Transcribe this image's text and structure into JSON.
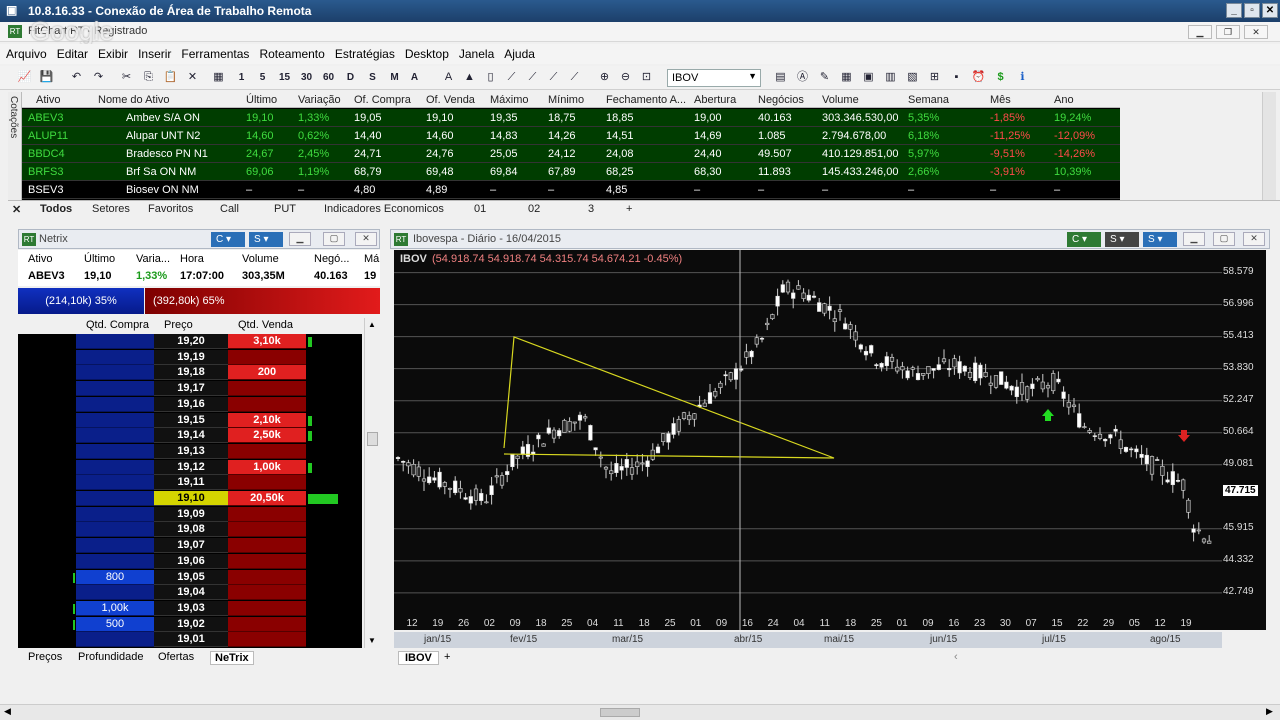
{
  "window": {
    "rd_title": "10.8.16.33 - Conexão de Área de Trabalho Remota",
    "app_title": "FitChart RT - Registrado",
    "watermark": "Google"
  },
  "menu": [
    "Arquivo",
    "Editar",
    "Exibir",
    "Inserir",
    "Ferramentas",
    "Roteamento",
    "Estratégias",
    "Desktop",
    "Janela",
    "Ajuda"
  ],
  "toolbar": {
    "symbol_select": "IBOV",
    "timeframes": [
      "1",
      "5",
      "15",
      "30",
      "60",
      "D",
      "S",
      "M",
      "A"
    ]
  },
  "quotes": {
    "side_label": "Cotações",
    "headers": [
      "Ativo",
      "Nome do Ativo",
      "Último",
      "Variação",
      "Of. Compra",
      "Of. Venda",
      "Máximo",
      "Mínimo",
      "Fechamento A...",
      "Abertura",
      "Negócios",
      "Volume",
      "Semana",
      "Mês",
      "Ano"
    ],
    "rows": [
      [
        "ABEV3",
        "Ambev S/A ON",
        "19,10",
        "1,33%",
        "19,05",
        "19,10",
        "19,35",
        "18,75",
        "18,85",
        "19,00",
        "40.163",
        "303.346.530,00",
        "5,35%",
        "-1,85%",
        "19,24%"
      ],
      [
        "ALUP11",
        "Alupar UNT N2",
        "14,60",
        "0,62%",
        "14,40",
        "14,60",
        "14,83",
        "14,26",
        "14,51",
        "14,69",
        "1.085",
        "2.794.678,00",
        "6,18%",
        "-11,25%",
        "-12,09%"
      ],
      [
        "BBDC4",
        "Bradesco PN N1",
        "24,67",
        "2,45%",
        "24,71",
        "24,76",
        "25,05",
        "24,12",
        "24,08",
        "24,40",
        "49.507",
        "410.129.851,00",
        "5,97%",
        "-9,51%",
        "-14,26%"
      ],
      [
        "BRFS3",
        "Brf Sa ON NM",
        "69,06",
        "1,19%",
        "68,79",
        "69,48",
        "69,84",
        "67,89",
        "68,25",
        "68,30",
        "11.893",
        "145.433.246,00",
        "2,66%",
        "-3,91%",
        "10,39%"
      ],
      [
        "BSEV3",
        "Biosev ON NM",
        "–",
        "–",
        "4,80",
        "4,89",
        "–",
        "–",
        "4,85",
        "–",
        "–",
        "–",
        "–",
        "–",
        "–"
      ]
    ],
    "tabs": [
      "Todos",
      "Setores",
      "Favoritos",
      "Call",
      "PUT",
      "Indicadores Economicos",
      "01",
      "02",
      "3"
    ]
  },
  "netrix": {
    "title": "Netrix",
    "headers": [
      "Ativo",
      "Último",
      "Varia...",
      "Hora",
      "Volume",
      "Negó...",
      "Má"
    ],
    "row": [
      "ABEV3",
      "19,10",
      "1,33%",
      "17:07:00",
      "303,35M",
      "40.163",
      "19"
    ],
    "buy_bar": "(214,10k) 35%",
    "sell_bar": "(392,80k) 65%",
    "book_headers": [
      "Qtd. Compra",
      "Preço",
      "Qtd. Venda"
    ],
    "book": [
      {
        "buy": "",
        "price": "19,20",
        "sell": "3,10k"
      },
      {
        "buy": "",
        "price": "19,19",
        "sell": ""
      },
      {
        "buy": "",
        "price": "19,18",
        "sell": "200"
      },
      {
        "buy": "",
        "price": "19,17",
        "sell": ""
      },
      {
        "buy": "",
        "price": "19,16",
        "sell": ""
      },
      {
        "buy": "",
        "price": "19,15",
        "sell": "2,10k"
      },
      {
        "buy": "",
        "price": "19,14",
        "sell": "2,50k"
      },
      {
        "buy": "",
        "price": "19,13",
        "sell": ""
      },
      {
        "buy": "",
        "price": "19,12",
        "sell": "1,00k"
      },
      {
        "buy": "",
        "price": "19,11",
        "sell": ""
      },
      {
        "buy": "",
        "price": "19,10",
        "sell": "20,50k"
      },
      {
        "buy": "",
        "price": "19,09",
        "sell": ""
      },
      {
        "buy": "",
        "price": "19,08",
        "sell": ""
      },
      {
        "buy": "",
        "price": "19,07",
        "sell": ""
      },
      {
        "buy": "",
        "price": "19,06",
        "sell": ""
      },
      {
        "buy": "800",
        "price": "19,05",
        "sell": ""
      },
      {
        "buy": "",
        "price": "19,04",
        "sell": ""
      },
      {
        "buy": "1,00k",
        "price": "19,03",
        "sell": ""
      },
      {
        "buy": "500",
        "price": "19,02",
        "sell": ""
      },
      {
        "buy": "",
        "price": "19,01",
        "sell": ""
      }
    ],
    "tabs": [
      "Preços",
      "Profundidade",
      "Ofertas",
      "NeTrix"
    ]
  },
  "chart": {
    "title": "Ibovespa - Diário - 16/04/2015",
    "legend_symbol": "IBOV",
    "legend_values": "(54.918.74  54.918.74  54.315.74  54.674.21  -0.45%)",
    "y_ticks": [
      "58.579",
      "56.996",
      "55.413",
      "53.830",
      "52.247",
      "50.664",
      "49.081",
      "47.715",
      "45.915",
      "44.332",
      "42.749"
    ],
    "current_price": "47.715",
    "x_days": [
      "12",
      "19",
      "26",
      "02",
      "09",
      "18",
      "25",
      "04",
      "11",
      "18",
      "25",
      "01",
      "09",
      "16",
      "24",
      "04",
      "11",
      "18",
      "25",
      "01",
      "09",
      "16",
      "23",
      "30",
      "07",
      "15",
      "22",
      "29",
      "05",
      "12",
      "19"
    ],
    "x_months": [
      "jan/15",
      "fev/15",
      "mar/15",
      "abr/15",
      "mai/15",
      "jun/15",
      "jul/15",
      "ago/15"
    ],
    "tab": "IBOV"
  }
}
